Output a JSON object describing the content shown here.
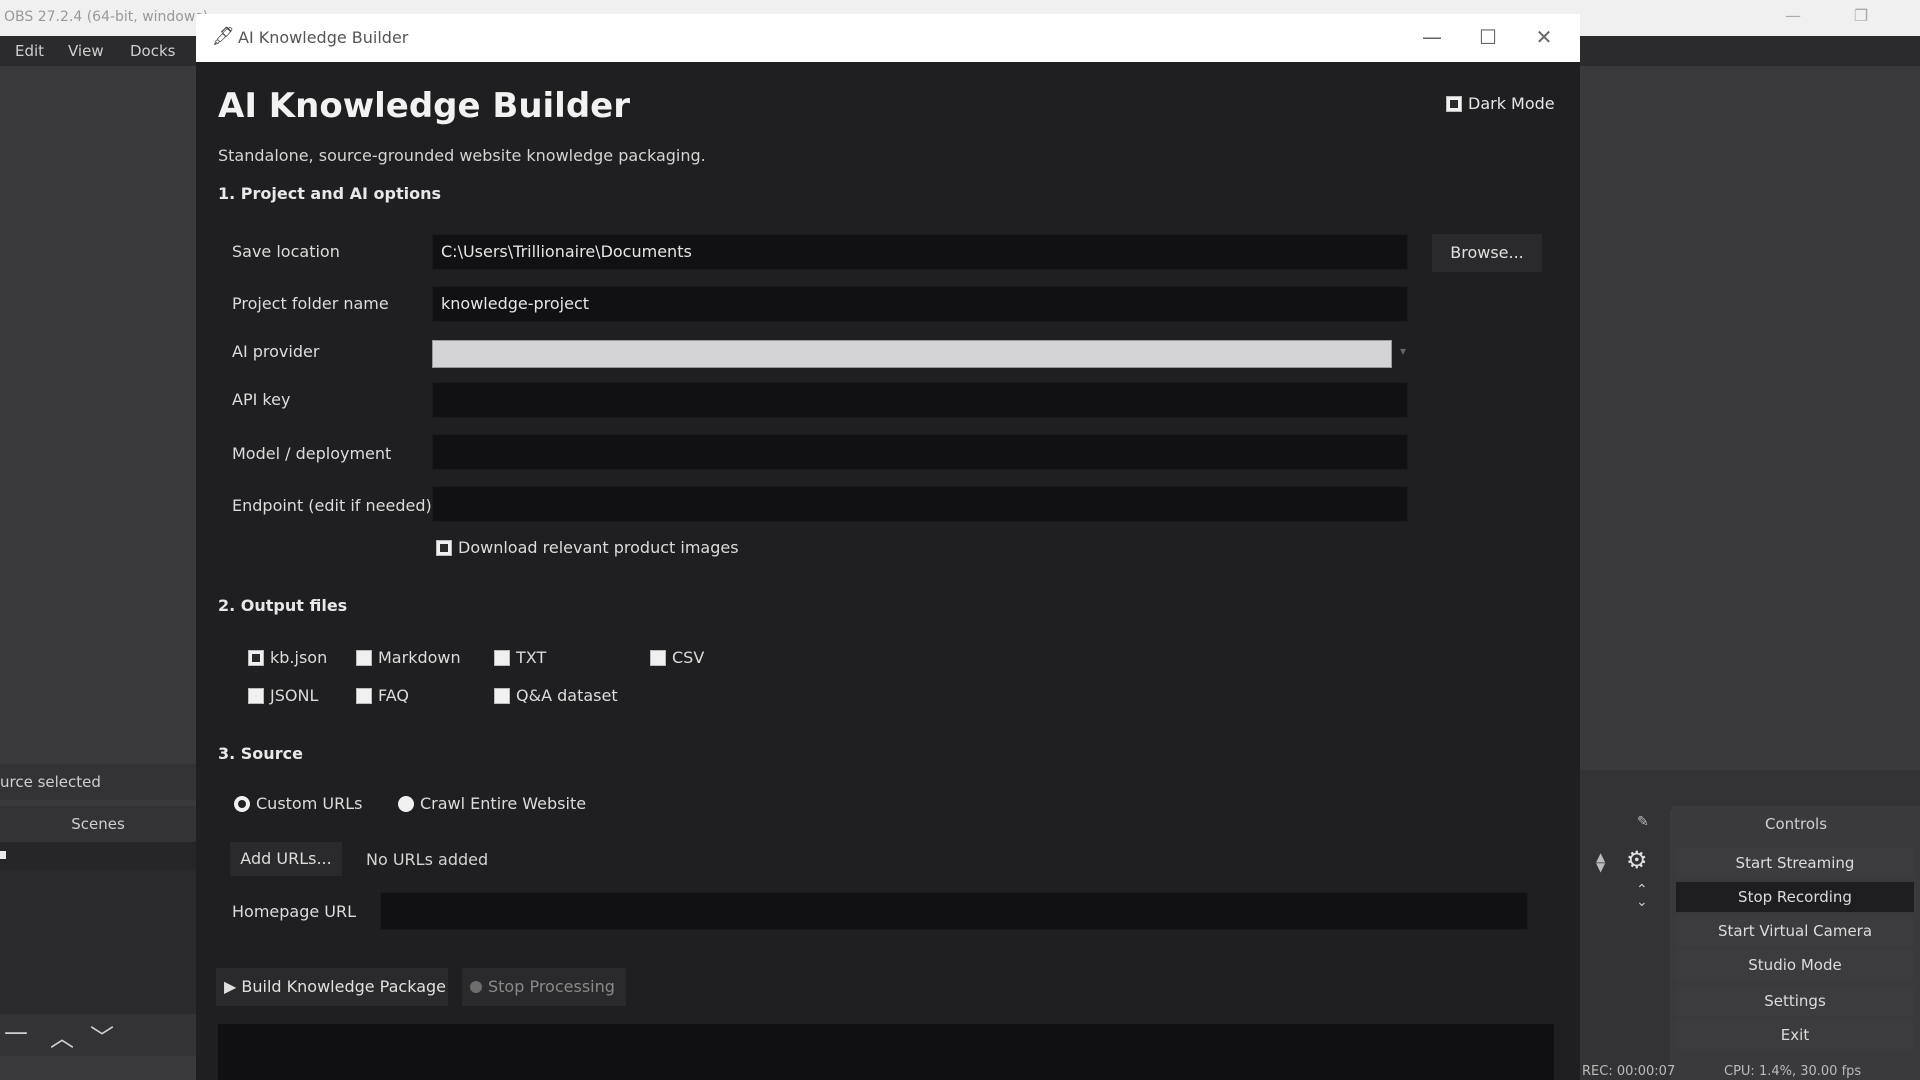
{
  "obs": {
    "window_title": "OBS 27.2.4 (64-bit, windows)",
    "menu": [
      "Edit",
      "View",
      "Docks"
    ],
    "source_status": "urce selected",
    "scenes_header": "Scenes",
    "controls_header": "Controls",
    "controls": [
      "Start Streaming",
      "Stop Recording",
      "Start Virtual Camera",
      "Studio Mode",
      "Settings",
      "Exit"
    ],
    "status_rec": "REC: 00:00:07",
    "status_cpu": "CPU: 1.4%, 30.00 fps"
  },
  "dialog": {
    "window_title": "AI Knowledge Builder",
    "title": "AI Knowledge Builder",
    "subtitle": "Standalone, source-grounded website knowledge packaging.",
    "dark_mode_label": "Dark Mode",
    "dark_mode_checked": true,
    "section1": "1. Project and AI options",
    "fields": {
      "save_location_label": "Save location",
      "save_location_value": "C:\\Users\\Trillionaire\\Documents",
      "browse_label": "Browse...",
      "project_folder_label": "Project folder name",
      "project_folder_value": "knowledge-project",
      "ai_provider_label": "AI provider",
      "ai_provider_value": "",
      "api_key_label": "API key",
      "api_key_value": "",
      "model_label": "Model / deployment",
      "model_value": "",
      "endpoint_label": "Endpoint (edit if needed)",
      "endpoint_value": ""
    },
    "download_images_label": "Download relevant product images",
    "download_images_checked": true,
    "section2": "2. Output files",
    "outputs": [
      {
        "label": "kb.json",
        "checked": true
      },
      {
        "label": "Markdown",
        "checked": false
      },
      {
        "label": "TXT",
        "checked": false
      },
      {
        "label": "CSV",
        "checked": false
      },
      {
        "label": "JSONL",
        "checked": false
      },
      {
        "label": "FAQ",
        "checked": false
      },
      {
        "label": "Q&A dataset",
        "checked": false
      }
    ],
    "section3": "3. Source",
    "source_options": [
      {
        "label": "Custom URLs",
        "checked": true
      },
      {
        "label": "Crawl Entire Website",
        "checked": false
      }
    ],
    "add_urls_label": "Add URLs...",
    "no_urls_label": "No URLs added",
    "homepage_label": "Homepage URL",
    "homepage_value": "",
    "build_label": "Build Knowledge Package",
    "stop_label": "Stop Processing"
  }
}
